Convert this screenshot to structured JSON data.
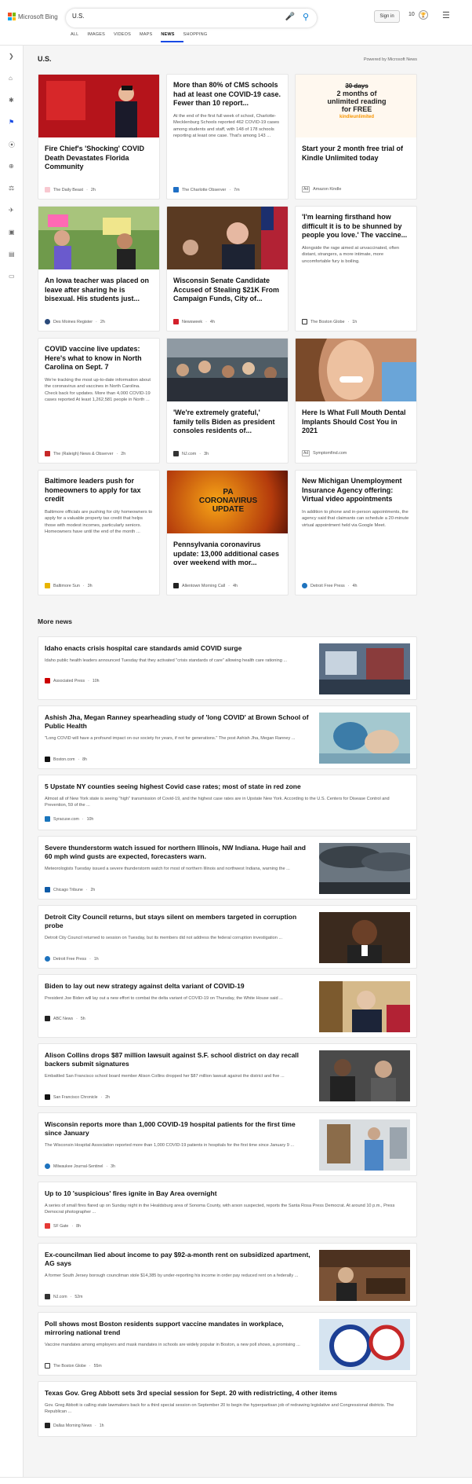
{
  "header": {
    "brand": "Microsoft Bing",
    "query": "U.S.",
    "signin": "Sign in",
    "points": "10",
    "menu_icon": "hamburger-icon"
  },
  "tabs": [
    "ALL",
    "IMAGES",
    "VIDEOS",
    "MAPS",
    "NEWS",
    "SHOPPING"
  ],
  "active_tab": "NEWS",
  "page": {
    "title": "U.S.",
    "powered": "Powered by Microsoft News",
    "more_news": "More news"
  },
  "cards": [
    {
      "title": "Fire Chief's 'Shocking' COVID Death Devastates Florida Community",
      "snippet": "",
      "source": "The Daily Beast",
      "time": "2h",
      "ad": false
    },
    {
      "title": "More than 80% of CMS schools had at least one COVID-19 case. Fewer than 10 report...",
      "snippet": "At the end of the first full week of school, Charlotte-Mecklenburg Schools reported 462 COVID-19 cases among students and staff, with 148 of 178 schools reporting at least one case. That's among 143 ...",
      "source": "The Charlotte Observer",
      "time": "7m",
      "ad": false
    },
    {
      "title": "Start your 2 month free trial of Kindle Unlimited today",
      "snippet": "",
      "source": "Amazon Kindle",
      "time": "",
      "ad": true,
      "promo": {
        "line1": "30 days",
        "line2": "2 months of",
        "line3": "unlimited reading",
        "line4": "for FREE",
        "brand": "kindleunlimited"
      }
    },
    {
      "title": "An Iowa teacher was placed on leave after sharing he is bisexual. His students just...",
      "snippet": "",
      "source": "Des Moines Register",
      "time": "2h",
      "ad": false
    },
    {
      "title": "Wisconsin Senate Candidate Accused of Stealing $21K From Campaign Funds, City of...",
      "snippet": "",
      "source": "Newsweek",
      "time": "4h",
      "ad": false
    },
    {
      "title": "'I'm learning firsthand how difficult it is to be shunned by people you love.' The vaccine...",
      "snippet": "Alongside the rage aimed at unvaccinated, often distant, strangers, a more intimate, more uncomfortable fury is boiling.",
      "source": "The Boston Globe",
      "time": "1h",
      "ad": false
    },
    {
      "title": "COVID vaccine live updates: Here's what to know in North Carolina on Sept. 7",
      "snippet": "We're tracking the most up-to-date information about the coronavirus and vaccines in North Carolina. Check back for updates. More than 4,000 COVID-19 cases reported At least 1,262,581 people in North ...",
      "source": "The (Raleigh) News & Observer",
      "time": "2h",
      "ad": false
    },
    {
      "title": "'We're extremely grateful,' family tells Biden as president consoles residents of...",
      "snippet": "",
      "source": "NJ.com",
      "time": "3h",
      "ad": false
    },
    {
      "title": "Here Is What Full Mouth Dental Implants Should Cost You in 2021",
      "snippet": "",
      "source": "Symptomfind.com",
      "time": "",
      "ad": true
    },
    {
      "title": "Baltimore leaders push for homeowners to apply for tax credit",
      "snippet": "Baltimore officials are pushing for city homeowners to apply for a valuable property tax credit that helps those with modest incomes, particularly seniors. Homeowners have until the end of the month ...",
      "source": "Baltimore Sun",
      "time": "3h",
      "ad": false
    },
    {
      "title": "Pennsylvania coronavirus update: 13,000 additional cases over weekend with mor...",
      "snippet": "",
      "source": "Allentown Morning Call",
      "time": "4h",
      "ad": false,
      "promo": {
        "line1": "PA",
        "line2": "CORONAVIRUS",
        "line3": "UPDATE"
      }
    },
    {
      "title": "New Michigan Unemployment Insurance Agency offering: Virtual video appointments",
      "snippet": "In addition to phone and in-person appointments, the agency said that claimants can schedule a 20-minute virtual appointment held via Google Meet.",
      "source": "Detroit Free Press",
      "time": "4h",
      "ad": false
    }
  ],
  "ad_label": "Ad",
  "more": [
    {
      "title": "Idaho enacts crisis hospital care standards amid COVID surge",
      "snippet": "Idaho public health leaders announced Tuesday that they activated \"crisis standards of care\" allowing health care rationing ...",
      "source": "Associated Press",
      "time": "10h"
    },
    {
      "title": "Ashish Jha, Megan Ranney spearheading study of 'long COVID' at Brown School of Public Health",
      "snippet": "\"Long COVID will have a profound impact on our society for years, if not for generations.\" The post Ashish Jha, Megan Ranney ...",
      "source": "Boston.com",
      "time": "8h"
    },
    {
      "title": "5 Upstate NY counties seeing highest Covid case rates; most of state in red zone",
      "snippet": "Almost all of New York state is seeing \"high\" transmission of Covid-19, and the highest case rates are in Upstate New York. According to the U.S. Centers for Disease Control and Prevention, 59 of the ...",
      "source": "Syracuse.com",
      "time": "10h"
    },
    {
      "title": "Severe thunderstorm watch issued for northern Illinois, NW Indiana. Huge hail and 60 mph wind gusts are expected, forecasters warn.",
      "snippet": "Meteorologists Tuesday issued a severe thunderstorm watch for most of northern Illinois and northwest Indiana, warning the ...",
      "source": "Chicago Tribune",
      "time": "2h"
    },
    {
      "title": "Detroit City Council returns, but stays silent on members targeted in corruption probe",
      "snippet": "Detroit City Council returned to session on Tuesday, but its members did not address the federal corruption investigation ...",
      "source": "Detroit Free Press",
      "time": "1h"
    },
    {
      "title": "Biden to lay out new strategy against delta variant of COVID-19",
      "snippet": "President Joe Biden will lay out a new effort to combat the delta variant of COVID-19 on Thursday, the White House said ...",
      "source": "ABC News",
      "time": "5h"
    },
    {
      "title": "Alison Collins drops $87 million lawsuit against S.F. school district on day recall backers submit signatures",
      "snippet": "Embattled San Francisco school board member Alison Collins dropped her $87 million lawsuit against the district and five ...",
      "source": "San Francisco Chronicle",
      "time": "2h"
    },
    {
      "title": "Wisconsin reports more than 1,000 COVID-19 hospital patients for the first time since January",
      "snippet": "The Wisconsin Hospital Association reported more than 1,000 COVID-19 patients in hospitals for the first time since January 9 ...",
      "source": "Milwaukee Journal-Sentinel",
      "time": "3h"
    },
    {
      "title": "Up to 10 'suspicious' fires ignite in Bay Area overnight",
      "snippet": "A series of small fires flared up on Sunday night in the Healdsburg area of Sonoma County, with arson suspected, reports the Santa Rosa Press Democrat. At around 10 p.m., Press Democrat photographer ...",
      "source": "SF Gate",
      "time": "8h"
    },
    {
      "title": "Ex-councilman lied about income to pay $92-a-month rent on subsidized apartment, AG says",
      "snippet": "A former South Jersey borough councilman stole $14,385 by under-reporting his income in order pay reduced rent on a federally ...",
      "source": "NJ.com",
      "time": "52m"
    },
    {
      "title": "Poll shows most Boston residents support vaccine mandates in workplace, mirroring national trend",
      "snippet": "Vaccine mandates among employers and mask mandates in schools are widely popular in Boston, a new poll shows, a promising ...",
      "source": "The Boston Globe",
      "time": "55m"
    },
    {
      "title": "Texas Gov. Greg Abbott sets 3rd special session for Sept. 20 with redistricting, 4 other items",
      "snippet": "Gov. Greg Abbott is calling state lawmakers back for a third special session on September 20 to begin the hyperpartisan job of redrawing legislative and Congressional districts. The Republican ...",
      "source": "Dallas Morning News",
      "time": "1h"
    }
  ],
  "colors": {
    "accent": "#174ae4",
    "bing_red": "#f25022",
    "bing_green": "#7fba00",
    "bing_blue": "#00a4ef",
    "bing_yellow": "#ffb900"
  }
}
